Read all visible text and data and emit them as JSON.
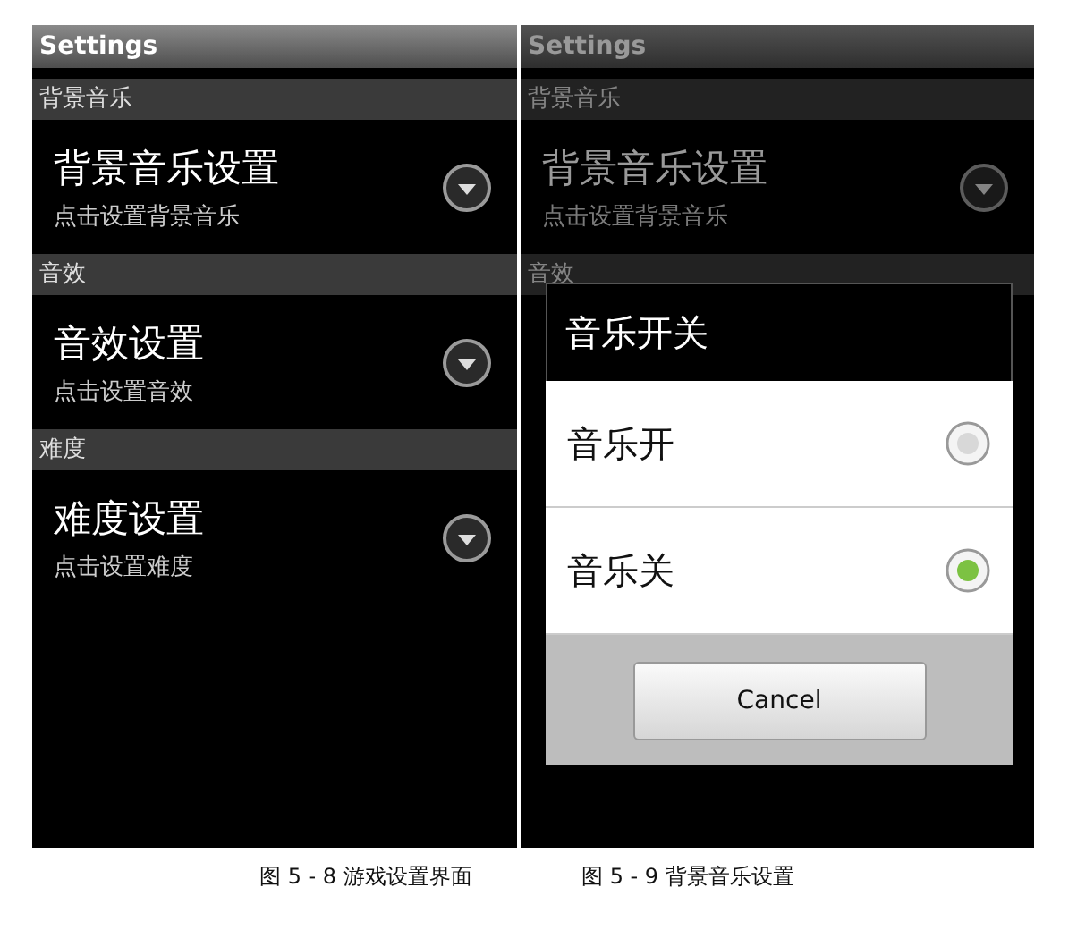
{
  "screens": [
    {
      "title": "Settings",
      "dimmed": false,
      "sections": [
        {
          "header": "背景音乐",
          "title": "背景音乐设置",
          "summary": "点击设置背景音乐"
        },
        {
          "header": "音效",
          "title": "音效设置",
          "summary": "点击设置音效"
        },
        {
          "header": "难度",
          "title": "难度设置",
          "summary": "点击设置难度"
        }
      ]
    },
    {
      "title": "Settings",
      "dimmed": true,
      "sections": [
        {
          "header": "背景音乐",
          "title": "背景音乐设置",
          "summary": "点击设置背景音乐"
        },
        {
          "header": "音效"
        }
      ],
      "dialog": {
        "title": "音乐开关",
        "options": [
          {
            "label": "音乐开",
            "selected": false
          },
          {
            "label": "音乐关",
            "selected": true
          }
        ],
        "button": "Cancel"
      }
    }
  ],
  "captions": [
    "图 5 - 8 游戏设置界面",
    "图 5 - 9 背景音乐设置"
  ]
}
